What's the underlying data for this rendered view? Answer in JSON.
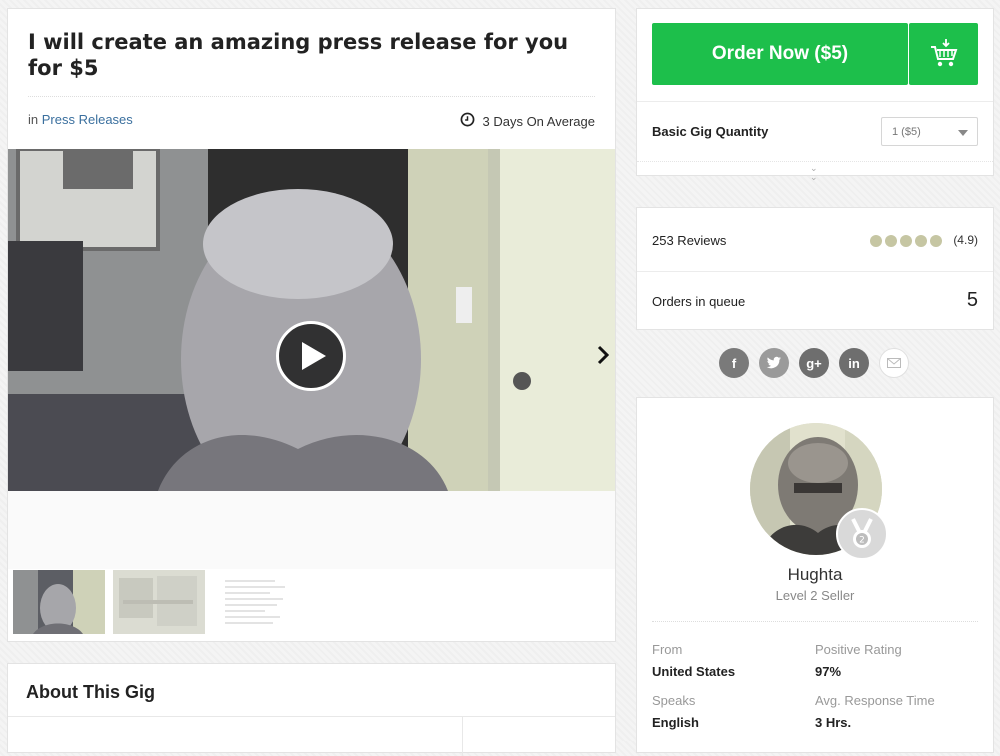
{
  "gig": {
    "title": "I will create an amazing press release for you for $5",
    "category_prefix": "in",
    "category": "Press Releases",
    "delivery": "3 Days On Average"
  },
  "about": {
    "title": "About This Gig"
  },
  "order": {
    "button_label": "Order Now ($5)",
    "quantity_label": "Basic Gig Quantity",
    "quantity_value": "1 ($5)",
    "accent_color": "#1dbf4b"
  },
  "stats": {
    "reviews": "253 Reviews",
    "rating_stars": 5,
    "rating": "(4.9)",
    "queue_label": "Orders in queue",
    "queue_value": "5"
  },
  "social": {
    "icons": [
      "facebook-icon",
      "twitter-icon",
      "google-plus-icon",
      "linkedin-icon",
      "email-icon"
    ],
    "facebook_glyph": "f",
    "google_glyph": "g+",
    "linkedin_glyph": "in"
  },
  "seller": {
    "name": "Hughta",
    "level": "Level 2 Seller",
    "from_label": "From",
    "from_value": "United States",
    "positive_label": "Positive Rating",
    "positive_value": "97%",
    "speaks_label": "Speaks",
    "speaks_value": "English",
    "response_label": "Avg. Response Time",
    "response_value": "3 Hrs."
  }
}
